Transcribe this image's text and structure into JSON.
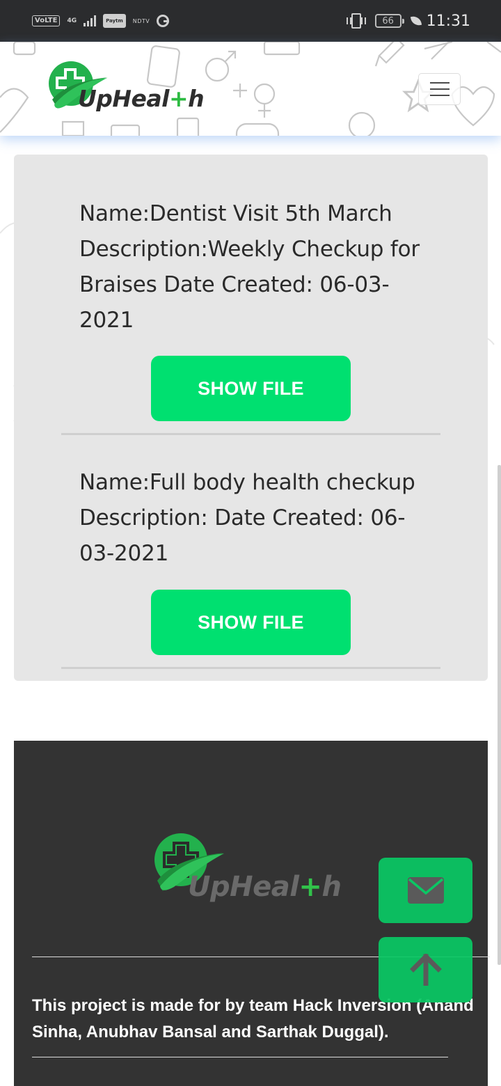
{
  "status_bar": {
    "volte": "VoLTE",
    "network": "4G",
    "paytm": "Paytm",
    "ndtv": "NDTV",
    "battery": "66",
    "time": "11:31"
  },
  "header": {
    "logo_text_a": "UpHeal",
    "logo_text_plus": "+",
    "logo_text_b": "h"
  },
  "records": [
    {
      "text": "Name:Dentist Visit 5th March Description:Weekly Checkup for Braises Date Created: 06-03-2021",
      "button_label": "SHOW FILE"
    },
    {
      "text": "Name:Full body health checkup Description: Date Created: 06-03-2021",
      "button_label": "SHOW FILE"
    }
  ],
  "footer": {
    "logo_text_a": "UpHeal",
    "logo_text_plus": "+",
    "logo_text_b": "h",
    "credits": "This project is made for by team Hack Inversion (Anand Sinha, Anubhav Bansal and Sarthak Duggal)."
  },
  "icons": {
    "mail": "envelope-icon",
    "scroll_top": "arrow-up-icon",
    "menu": "hamburger-icon"
  },
  "colors": {
    "accent_green": "#00e070",
    "float_green": "#0ac864",
    "card_bg": "#e6e6e6",
    "footer_bg": "#333333",
    "status_bar_bg": "#2b2c2e"
  }
}
